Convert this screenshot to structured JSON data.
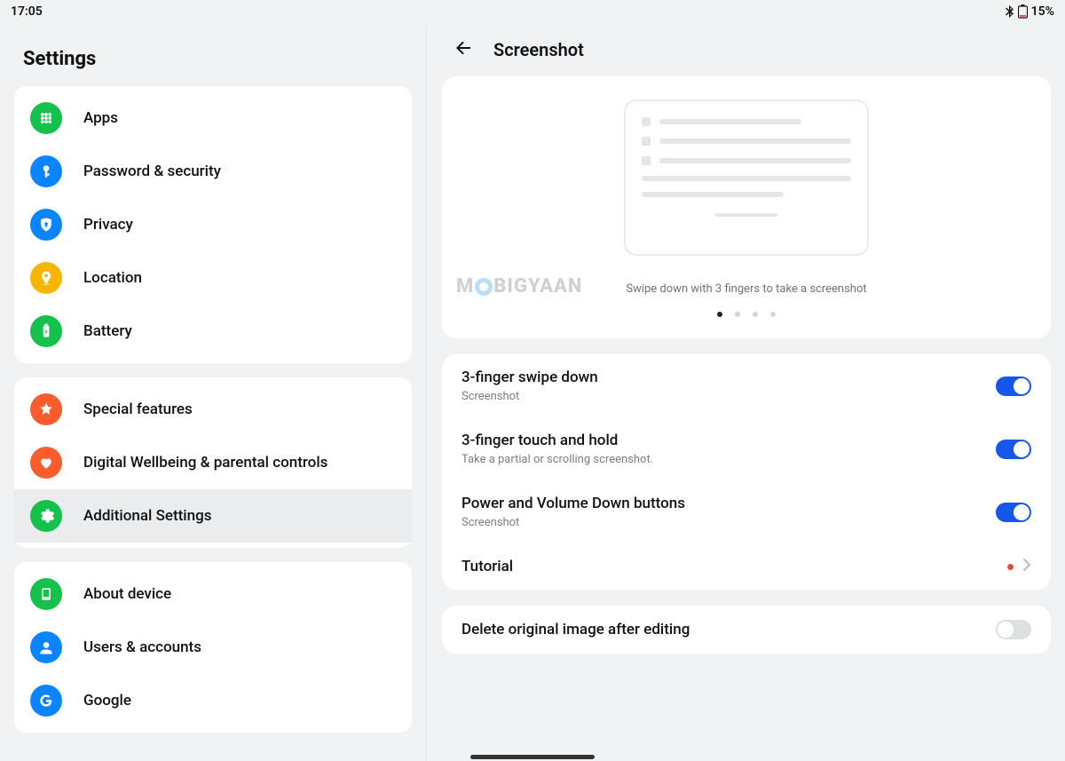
{
  "statusbar": {
    "time": "17:05",
    "battery_pct": "15%"
  },
  "sidebar": {
    "title": "Settings",
    "groups": [
      {
        "items": [
          {
            "label": "Apps",
            "icon": "apps-icon",
            "color": "bg-green"
          },
          {
            "label": "Password & security",
            "icon": "key-icon",
            "color": "bg-blue"
          },
          {
            "label": "Privacy",
            "icon": "privacy-icon",
            "color": "bg-blue"
          },
          {
            "label": "Location",
            "icon": "location-icon",
            "color": "bg-yellow"
          },
          {
            "label": "Battery",
            "icon": "battery-icon",
            "color": "bg-green"
          }
        ]
      },
      {
        "items": [
          {
            "label": "Special features",
            "icon": "star-icon",
            "color": "bg-orange"
          },
          {
            "label": "Digital Wellbeing & parental controls",
            "icon": "heart-icon",
            "color": "bg-orange"
          },
          {
            "label": "Additional Settings",
            "icon": "gear-icon",
            "color": "bg-green",
            "selected": true
          }
        ]
      },
      {
        "items": [
          {
            "label": "About device",
            "icon": "device-icon",
            "color": "bg-green"
          },
          {
            "label": "Users & accounts",
            "icon": "user-icon",
            "color": "bg-blue"
          },
          {
            "label": "Google",
            "icon": "google-icon",
            "color": "bg-blue"
          }
        ]
      }
    ]
  },
  "detail": {
    "title": "Screenshot",
    "demo_caption": "Swipe down with 3 fingers to take a screenshot",
    "watermark": "MOBIGYAAN",
    "page_dots": {
      "count": 4,
      "active": 0
    },
    "settings": [
      {
        "title": "3-finger swipe down",
        "sub": "Screenshot",
        "kind": "toggle",
        "value": true
      },
      {
        "title": "3-finger touch and hold",
        "sub": "Take a partial or scrolling screenshot.",
        "kind": "toggle",
        "value": true
      },
      {
        "title": "Power and Volume Down buttons",
        "sub": "Screenshot",
        "kind": "toggle",
        "value": true
      },
      {
        "title": "Tutorial",
        "sub": "",
        "kind": "link",
        "has_dot": true
      }
    ],
    "extra": [
      {
        "title": "Delete original image after editing",
        "sub": "",
        "kind": "toggle",
        "value": false
      }
    ]
  }
}
